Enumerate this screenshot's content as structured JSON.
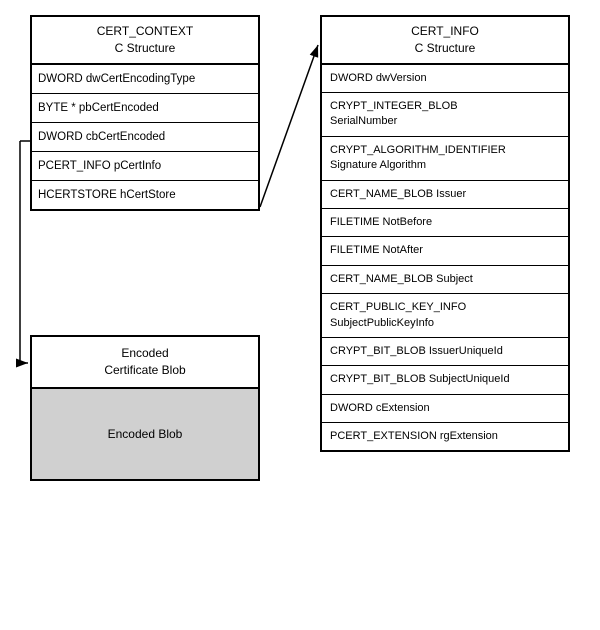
{
  "left": {
    "cert_context": {
      "title_line1": "CERT_CONTEXT",
      "title_line2": "C Structure",
      "rows": [
        "DWORD dwCertEncodingType",
        "BYTE *  pbCertEncoded",
        "DWORD  cbCertEncoded",
        "PCERT_INFO  pCertInfo",
        "HCERTSTORE  hCertStore"
      ]
    },
    "encoded_cert": {
      "title_line1": "Encoded",
      "title_line2": "Certificate Blob",
      "blob_label": "Encoded Blob"
    }
  },
  "right": {
    "cert_info": {
      "title_line1": "CERT_INFO",
      "title_line2": "C Structure",
      "rows": [
        "DWORD dwVersion",
        "CRYPT_INTEGER_BLOB\nSerialNumber",
        "CRYPT_ALGORITHM_IDENTIFIER\nSignature Algorithm",
        "CERT_NAME_BLOB Issuer",
        "FILETIME NotBefore",
        "FILETIME NotAfter",
        "CERT_NAME_BLOB Subject",
        "CERT_PUBLIC_KEY_INFO\nSubjectPublicKeyInfo",
        "CRYPT_BIT_BLOB IssuerUniqueId",
        "CRYPT_BIT_BLOB SubjectUniqueId",
        "DWORD cExtension",
        "PCERT_EXTENSION rgExtension"
      ]
    }
  }
}
